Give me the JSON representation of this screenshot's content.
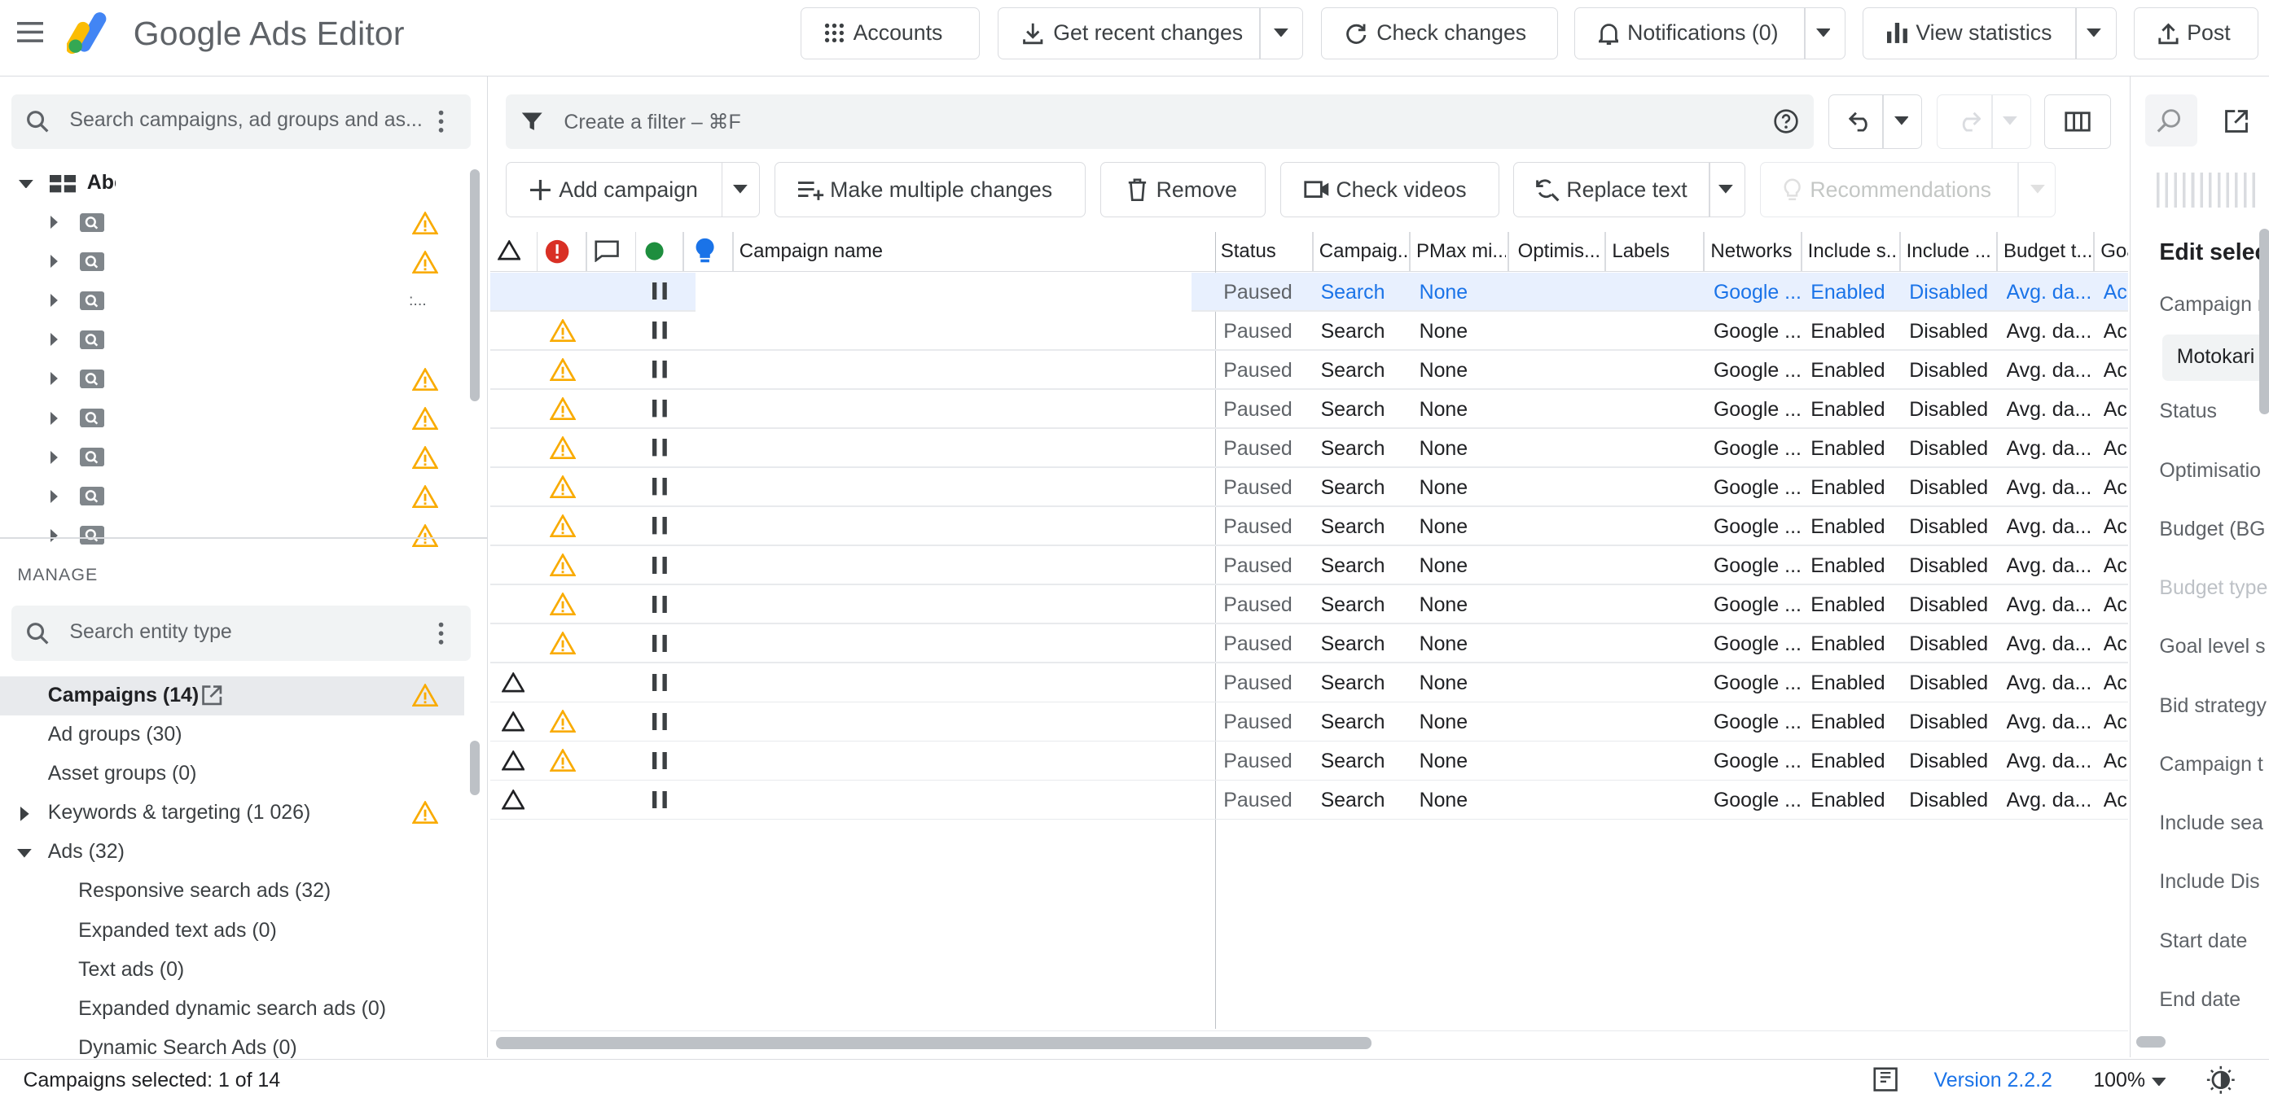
{
  "app": {
    "brand": "Google Ads Editor"
  },
  "toolbar": {
    "accounts": "Accounts",
    "get_recent_changes": "Get recent changes",
    "check_changes": "Check changes",
    "notifications": "Notifications (0)",
    "view_statistics": "View statistics",
    "post": "Post"
  },
  "left_panel": {
    "search_placeholder": "Search campaigns, ad groups and as...",
    "account_label": "Abc",
    "truncation": ":...",
    "manage_label": "MANAGE",
    "entity_search_placeholder": "Search entity type",
    "entities": [
      {
        "label": "Campaigns (14)"
      },
      {
        "label": "Ad groups (30)"
      },
      {
        "label": "Asset groups (0)"
      },
      {
        "label": "Keywords & targeting (1 026)"
      },
      {
        "label": "Ads (32)"
      },
      {
        "label": "Responsive search ads (32)"
      },
      {
        "label": "Expanded text ads (0)"
      },
      {
        "label": "Text ads (0)"
      },
      {
        "label": "Expanded dynamic search ads (0)"
      },
      {
        "label": "Dynamic Search Ads (0)"
      }
    ]
  },
  "filter": {
    "placeholder": "Create a filter – ⌘F"
  },
  "actions": {
    "add_campaign": "Add campaign",
    "make_multiple_changes": "Make multiple changes",
    "remove": "Remove",
    "check_videos": "Check videos",
    "replace_text": "Replace text",
    "recommendations": "Recommendations"
  },
  "grid": {
    "columns": {
      "campaign_name": "Campaign name",
      "status": "Status",
      "campaign_type": "Campaig...",
      "pmax": "PMax mi...",
      "optimisation": "Optimis...",
      "labels": "Labels",
      "networks": "Networks",
      "include_search": "Include s...",
      "include_display": "Include ...",
      "budget_type": "Budget t...",
      "goal": "Goa"
    },
    "rows": [
      {
        "status": "Paused",
        "type": "Search",
        "pmax": "None",
        "networks": "Google ...",
        "inc_s": "Enabled",
        "inc_d": "Disabled",
        "budget": "Avg. da...",
        "goal": "Ac",
        "selected": true,
        "warn": false,
        "tri": false
      },
      {
        "status": "Paused",
        "type": "Search",
        "pmax": "None",
        "networks": "Google ...",
        "inc_s": "Enabled",
        "inc_d": "Disabled",
        "budget": "Avg. da...",
        "goal": "Ac",
        "selected": false,
        "warn": true,
        "tri": false
      },
      {
        "status": "Paused",
        "type": "Search",
        "pmax": "None",
        "networks": "Google ...",
        "inc_s": "Enabled",
        "inc_d": "Disabled",
        "budget": "Avg. da...",
        "goal": "Ac",
        "selected": false,
        "warn": true,
        "tri": false
      },
      {
        "status": "Paused",
        "type": "Search",
        "pmax": "None",
        "networks": "Google ...",
        "inc_s": "Enabled",
        "inc_d": "Disabled",
        "budget": "Avg. da...",
        "goal": "Ac",
        "selected": false,
        "warn": true,
        "tri": false
      },
      {
        "status": "Paused",
        "type": "Search",
        "pmax": "None",
        "networks": "Google ...",
        "inc_s": "Enabled",
        "inc_d": "Disabled",
        "budget": "Avg. da...",
        "goal": "Ac",
        "selected": false,
        "warn": true,
        "tri": false
      },
      {
        "status": "Paused",
        "type": "Search",
        "pmax": "None",
        "networks": "Google ...",
        "inc_s": "Enabled",
        "inc_d": "Disabled",
        "budget": "Avg. da...",
        "goal": "Ac",
        "selected": false,
        "warn": true,
        "tri": false
      },
      {
        "status": "Paused",
        "type": "Search",
        "pmax": "None",
        "networks": "Google ...",
        "inc_s": "Enabled",
        "inc_d": "Disabled",
        "budget": "Avg. da...",
        "goal": "Ac",
        "selected": false,
        "warn": true,
        "tri": false
      },
      {
        "status": "Paused",
        "type": "Search",
        "pmax": "None",
        "networks": "Google ...",
        "inc_s": "Enabled",
        "inc_d": "Disabled",
        "budget": "Avg. da...",
        "goal": "Ac",
        "selected": false,
        "warn": true,
        "tri": false
      },
      {
        "status": "Paused",
        "type": "Search",
        "pmax": "None",
        "networks": "Google ...",
        "inc_s": "Enabled",
        "inc_d": "Disabled",
        "budget": "Avg. da...",
        "goal": "Ac",
        "selected": false,
        "warn": true,
        "tri": false
      },
      {
        "status": "Paused",
        "type": "Search",
        "pmax": "None",
        "networks": "Google ...",
        "inc_s": "Enabled",
        "inc_d": "Disabled",
        "budget": "Avg. da...",
        "goal": "Ac",
        "selected": false,
        "warn": true,
        "tri": false
      },
      {
        "status": "Paused",
        "type": "Search",
        "pmax": "None",
        "networks": "Google ...",
        "inc_s": "Enabled",
        "inc_d": "Disabled",
        "budget": "Avg. da...",
        "goal": "Ac",
        "selected": false,
        "warn": false,
        "tri": true
      },
      {
        "status": "Paused",
        "type": "Search",
        "pmax": "None",
        "networks": "Google ...",
        "inc_s": "Enabled",
        "inc_d": "Disabled",
        "budget": "Avg. da...",
        "goal": "Ac",
        "selected": false,
        "warn": true,
        "tri": true
      },
      {
        "status": "Paused",
        "type": "Search",
        "pmax": "None",
        "networks": "Google ...",
        "inc_s": "Enabled",
        "inc_d": "Disabled",
        "budget": "Avg. da...",
        "goal": "Ac",
        "selected": false,
        "warn": true,
        "tri": true
      },
      {
        "status": "Paused",
        "type": "Search",
        "pmax": "None",
        "networks": "Google ...",
        "inc_s": "Enabled",
        "inc_d": "Disabled",
        "budget": "Avg. da...",
        "goal": "Ac",
        "selected": false,
        "warn": false,
        "tri": true
      }
    ]
  },
  "right_panel": {
    "title": "Edit selec",
    "campaign_label": "Campaign n",
    "campaign_value": "Motokari",
    "fields": [
      "Status",
      "Optimisatio",
      "Budget (BG",
      "Budget type",
      "Goal level s",
      "Bid strategy",
      "Campaign t",
      "Include sea",
      "Include Dis",
      "Start date",
      "End date"
    ]
  },
  "status_bar": {
    "selection": "Campaigns selected: 1 of 14",
    "version": "Version 2.2.2",
    "zoom": "100%"
  },
  "colors": {
    "accent": "#1a73e8",
    "warning": "#fbbc04",
    "error": "#d93025",
    "enabled_green": "#1e8e3e",
    "selected_row": "#e8f0fe"
  }
}
